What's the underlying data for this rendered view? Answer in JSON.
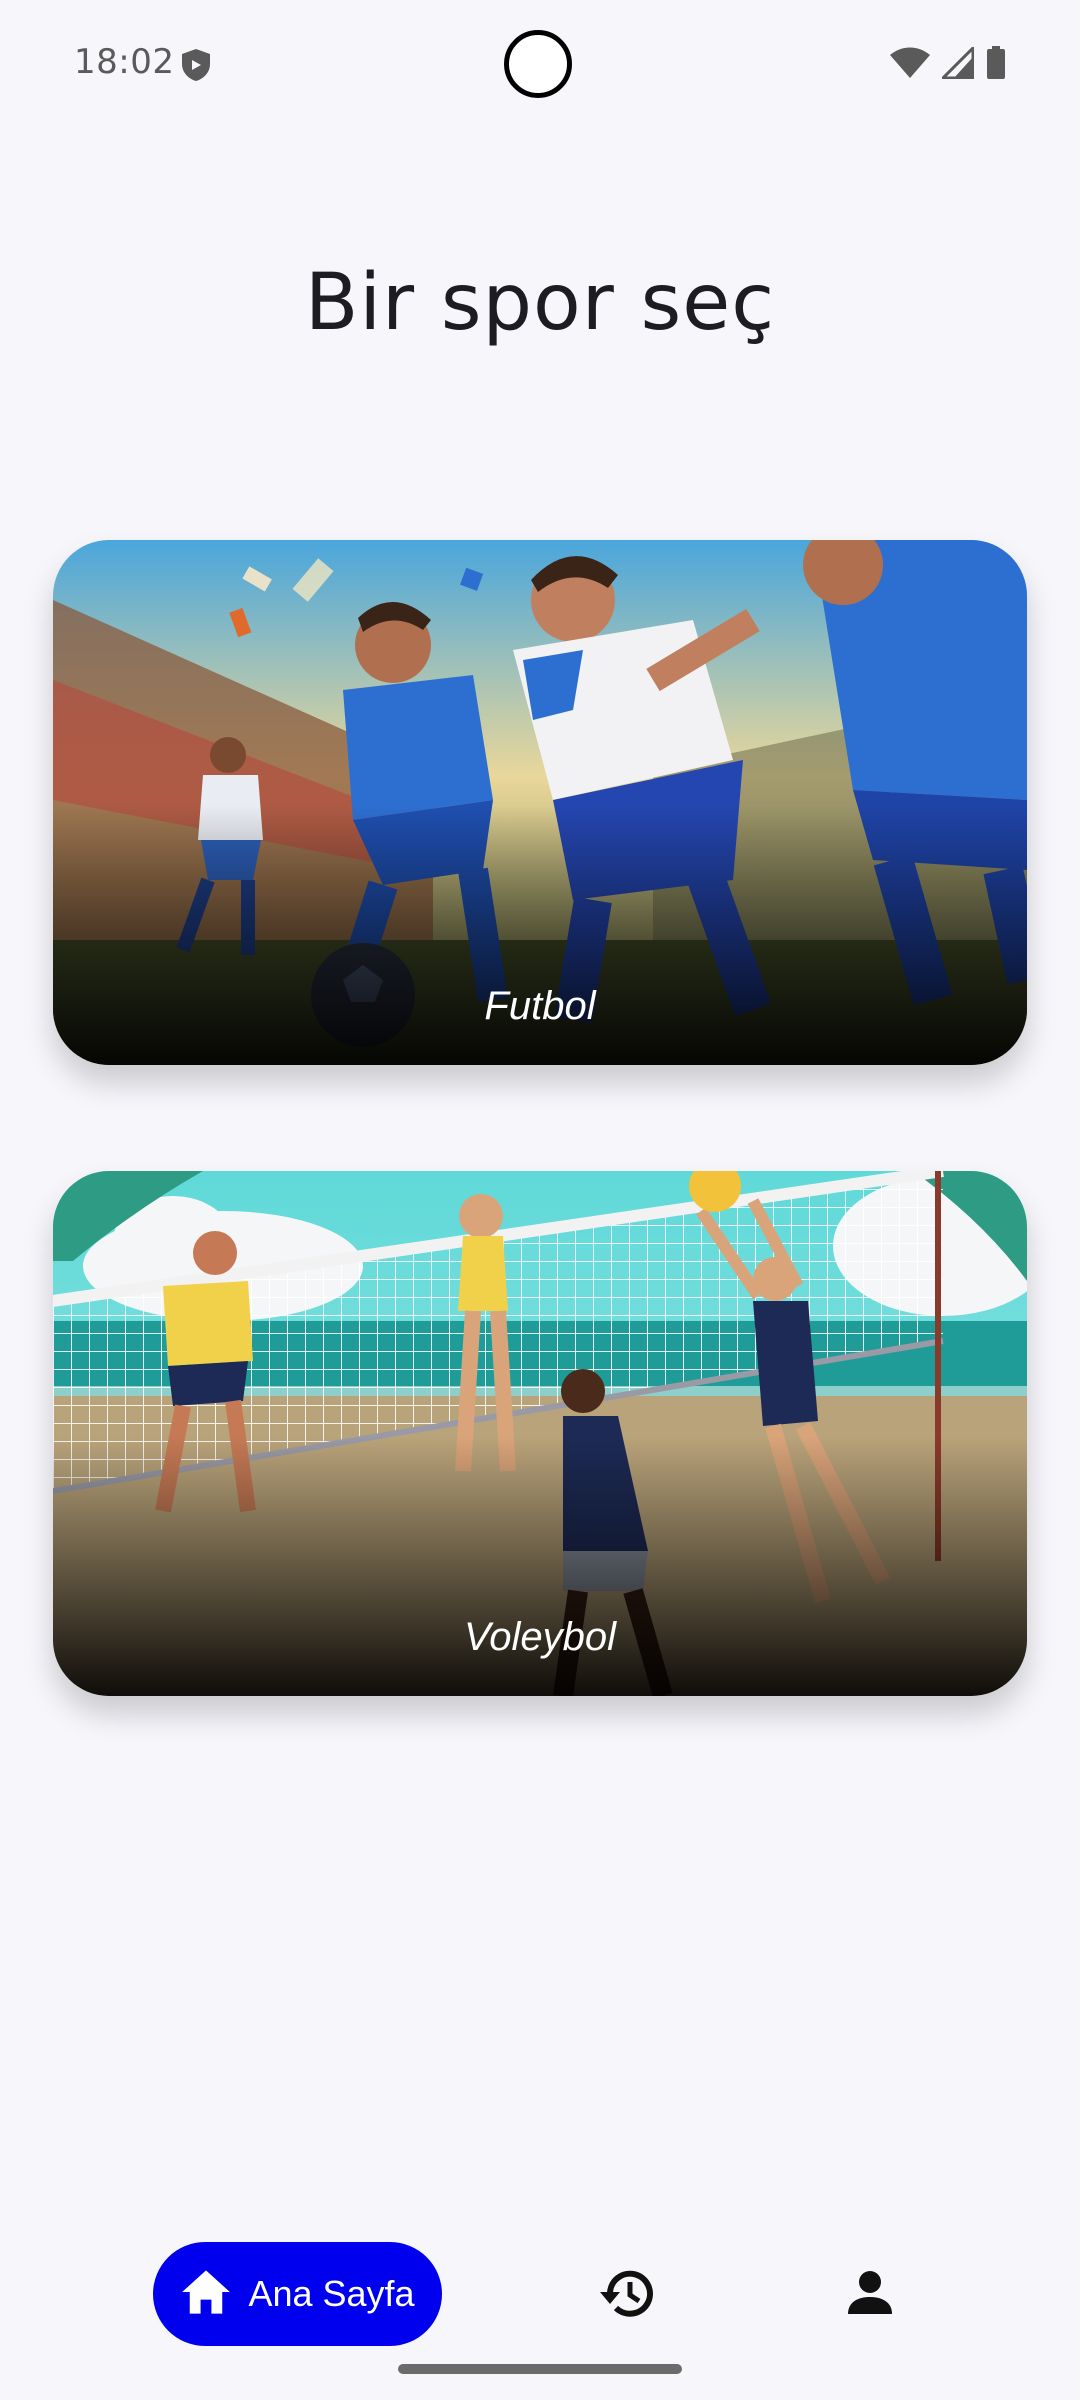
{
  "status_bar": {
    "time": "18:02",
    "icons": [
      "shield-icon",
      "wifi-icon",
      "signal-icon",
      "battery-icon"
    ]
  },
  "page": {
    "title": "Bir spor seç"
  },
  "sports": [
    {
      "label": "Futbol",
      "image": "football-players-illustration"
    },
    {
      "label": "Voleybol",
      "image": "beach-volleyball-illustration"
    }
  ],
  "bottom_nav": {
    "items": [
      {
        "label": "Ana Sayfa",
        "icon": "home-icon",
        "selected": true
      },
      {
        "label": "",
        "icon": "history-icon",
        "selected": false
      },
      {
        "label": "",
        "icon": "person-icon",
        "selected": false
      }
    ]
  },
  "colors": {
    "background": "#f7f6fb",
    "nav_selected": "#0000ee",
    "title_text": "#1d1c22"
  }
}
